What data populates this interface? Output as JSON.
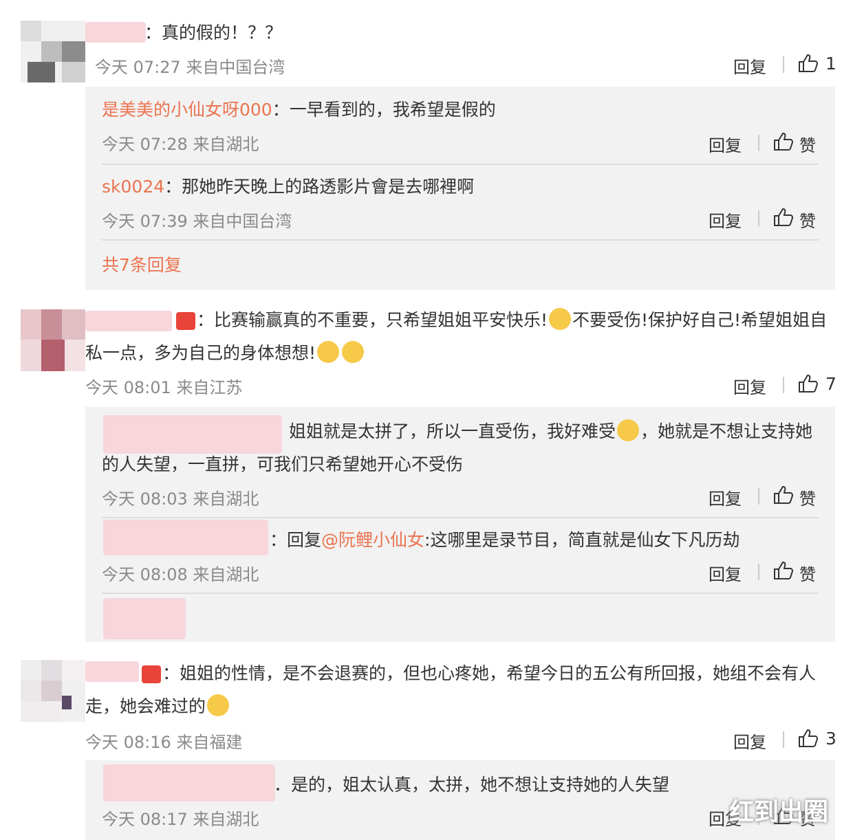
{
  "comments": [
    {
      "text": "：真的假的！？？",
      "meta": "今天 07:27 来自中国台湾",
      "reply_label": "回复",
      "likes": "1",
      "replies": [
        {
          "user": "是美美的小仙女呀000",
          "text": "：一早看到的，我希望是假的",
          "meta": "今天 07:28 来自湖北",
          "reply_label": "回复",
          "like_label": "赞"
        },
        {
          "user": "sk0024",
          "text": "：那她昨天晚上的路透影片會是去哪裡啊",
          "meta": "今天 07:39 来自中国台湾",
          "reply_label": "回复",
          "like_label": "赞"
        }
      ],
      "more_replies": "共7条回复"
    },
    {
      "text_line1": "：比赛输赢真的不重要，只希望姐姐平安快乐!",
      "text_line1b": "不要受伤!保护好自己!希望姐姐自",
      "text_line2": "私一点，多为自己的身体想想!",
      "meta": "今天 08:01 来自江苏",
      "reply_label": "回复",
      "likes": "7",
      "replies": [
        {
          "text_line1a": "姐姐就是太拼了，所以一直受伤，我好难受",
          "text_line1b": "，她就是不想让支持她",
          "text_line2": "的人失望，一直拼，可我们只希望她开心不受伤",
          "meta": "今天 08:03 来自湖北",
          "reply_label": "回复",
          "like_label": "赞"
        },
        {
          "prefix": "：回复",
          "mention": "@阮鲤小仙女",
          "text": ":这哪里是录节目，简直就是仙女下凡历劫",
          "meta": "今天 08:08 来自湖北",
          "reply_label": "回复",
          "like_label": "赞"
        }
      ]
    },
    {
      "text_line1": "：姐姐的性情，是不会退赛的，但也心疼她，希望今日的五公有所回报，她组不会有人",
      "text_line2": "走，她会难过的",
      "meta": "今天 08:16 来自福建",
      "reply_label": "回复",
      "likes": "3",
      "replies": [
        {
          "text": "．是的，姐太认真，太拼，她不想让支持她的人失望",
          "meta": "今天 08:17 来自湖北",
          "reply_label": "回复",
          "like_label": "赞"
        }
      ]
    }
  ],
  "watermark": "红到出圈",
  "colors": {
    "link": "#eb7350",
    "reply_bg": "#f2f2f2",
    "meta": "#8a8a8a"
  }
}
